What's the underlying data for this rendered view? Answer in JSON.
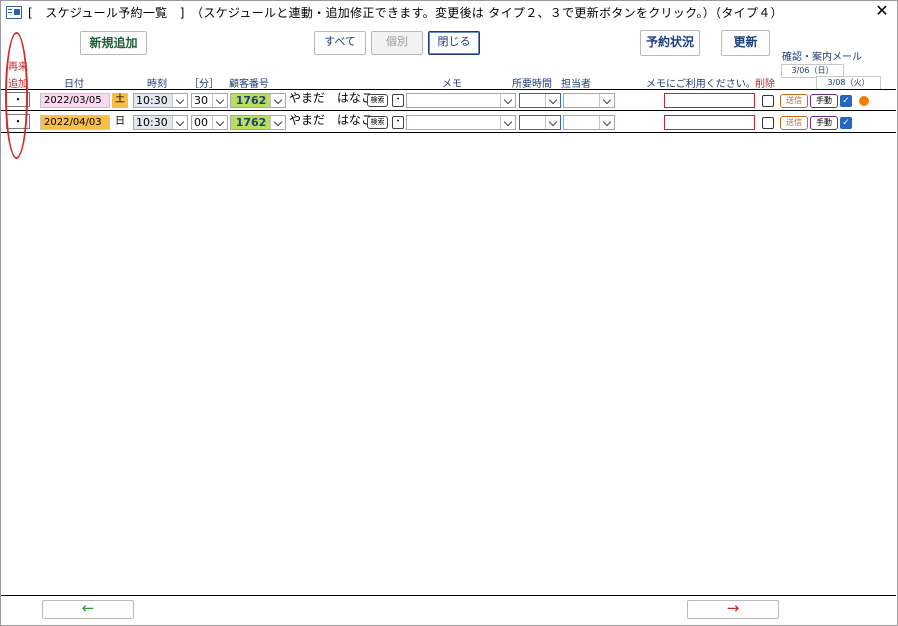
{
  "window": {
    "title": "[　スケジュール予約一覧　]　（スケジュールと連動・追加修正できます。変更後は タイプ２、３で更新ボタンをクリック。）（タイプ４）"
  },
  "toolbar": {
    "new_label": "新規追加",
    "all_label": "すべて",
    "individual_label": "個別",
    "close_label": "閉じる",
    "status_label": "予約状況",
    "update_label": "更新"
  },
  "mail": {
    "title": "確認・案内メール",
    "date1": "3/06（日）",
    "date2": "3/08（火）"
  },
  "headers": {
    "repeat_line1": "再来",
    "repeat_line2": "追加",
    "date": "日付",
    "time": "時刻",
    "minute": "［分］",
    "customer": "顧客番号",
    "memo": "メモ",
    "duration": "所要時間",
    "staff": "担当者",
    "memo2": "メモにご利用ください。",
    "delete": "削除"
  },
  "rows": [
    {
      "repeat": "・",
      "date": "2022/03/05",
      "dow": "土",
      "time": "10:30",
      "minute": "30",
      "customer": "1762",
      "name": "やまだ　はなこ",
      "search": "検索",
      "dot": "・",
      "send": "送信",
      "manual": "手動",
      "checked": true,
      "has_dot": true
    },
    {
      "repeat": "・",
      "date": "2022/04/03",
      "dow": "日",
      "time": "10:30",
      "minute": "00",
      "customer": "1762",
      "name": "やまだ　はなこ",
      "search": "検索",
      "dot": "・",
      "send": "送信",
      "manual": "手動",
      "checked": true,
      "has_dot": false
    }
  ],
  "footer": {
    "back_arrow": "←",
    "forward_arrow": "→"
  },
  "colors": {
    "accent_red": "#c0282b",
    "header_blue": "#1f3b77",
    "back_arrow": "#2a9a3c",
    "forward_arrow": "#c0282b"
  }
}
